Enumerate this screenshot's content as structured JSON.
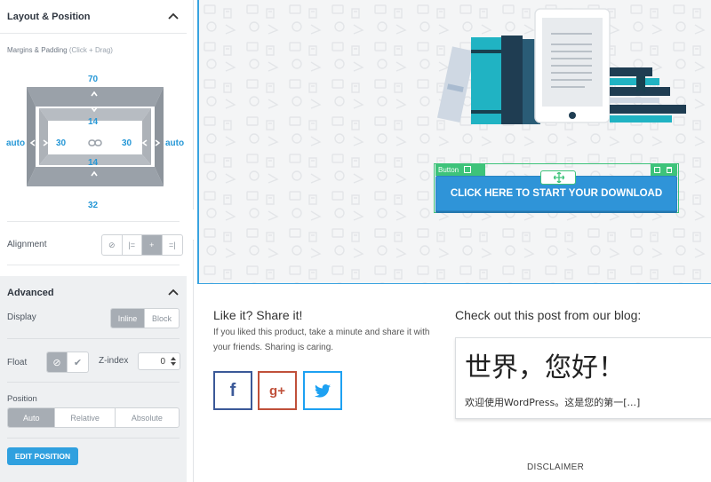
{
  "sidebar": {
    "layout_title": "Layout & Position",
    "margins_label": "Margins & Padding",
    "margins_hint": "(Click + Drag)",
    "box": {
      "margin_top": "70",
      "padding_top": "14",
      "padding_left": "30",
      "padding_right": "30",
      "padding_bottom": "14",
      "margin_bottom": "32",
      "margin_left": "auto",
      "margin_right": "auto"
    },
    "alignment_label": "Alignment",
    "alignment_options": [
      "none",
      "left",
      "center",
      "right"
    ],
    "alignment_selected": "center",
    "advanced_title": "Advanced",
    "display_label": "Display",
    "display_options": [
      "Inline",
      "Block"
    ],
    "display_selected": "Inline",
    "float_label": "Float",
    "float_options": [
      "none",
      "check"
    ],
    "float_selected": "none",
    "zindex_label": "Z-index",
    "zindex_value": "0",
    "position_label": "Position",
    "position_options": [
      "Auto",
      "Relative",
      "Absolute"
    ],
    "position_selected": "Auto",
    "edit_position_label": "EDIT POSITION"
  },
  "canvas": {
    "button_tag": "Button",
    "cta_label": "CLICK HERE TO START YOUR DOWNLOAD"
  },
  "share": {
    "title": "Like it? Share it!",
    "text": "If you liked this product, take a minute and share it with your friends. Sharing is caring.",
    "facebook": "f",
    "google": "g+",
    "twitter": "twitter-icon"
  },
  "blog": {
    "title": "Check out this post from our blog:",
    "post_title": "世界，您好！",
    "excerpt": "欢迎使用WordPress。这是您的第一[...]"
  },
  "footer": {
    "disclaimer": "DISCLAIMER"
  },
  "colors": {
    "accent": "#2f94d8",
    "selection": "#3ec37a",
    "facebook": "#3b5998",
    "google": "#c0503a",
    "twitter": "#1da1f2"
  }
}
